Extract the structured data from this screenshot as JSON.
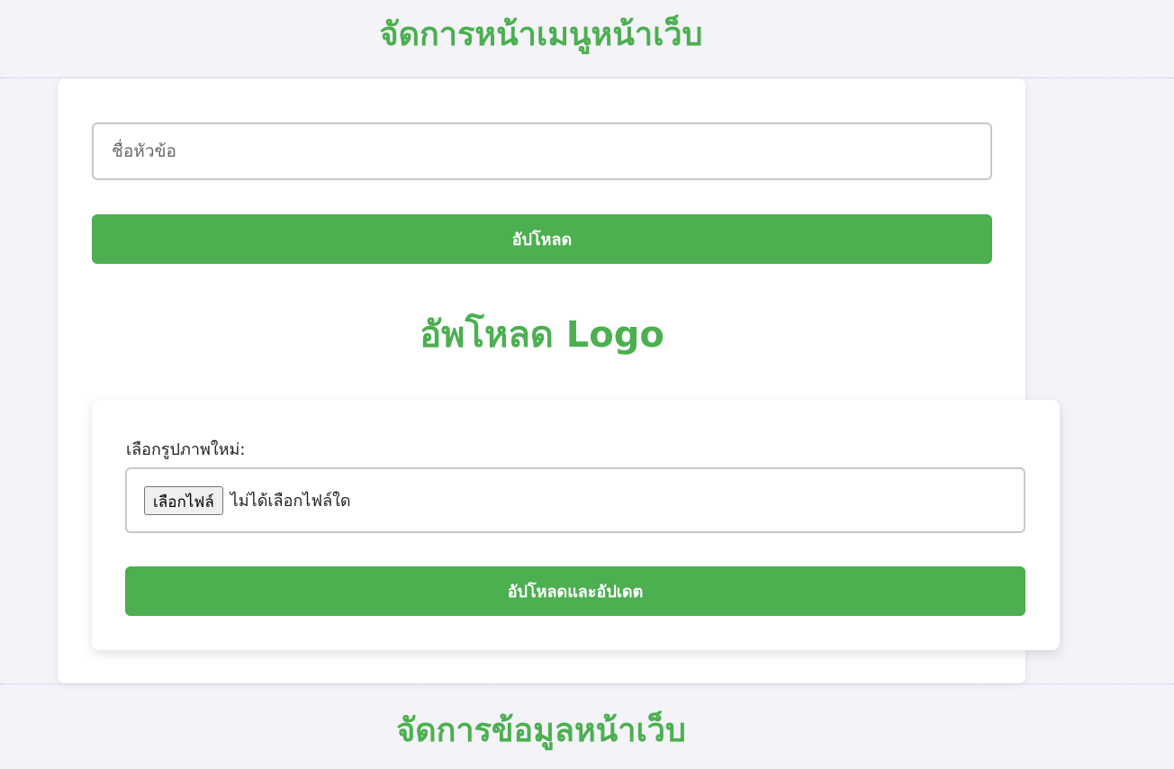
{
  "headings": {
    "menu_section": "จัดการหน้าเมนูหน้าเว็บ",
    "logo_section": "อัพโหลด Logo",
    "data_section": "จัดการข้อมูลหน้าเว็บ"
  },
  "topic_form": {
    "title_input_placeholder": "ชื่อหัวข้อ",
    "title_input_value": "",
    "upload_button_label": "อัปโหลด"
  },
  "logo_form": {
    "file_label": "เลือกรูปภาพใหม่:",
    "choose_file_label": "เลือกไฟล์",
    "file_status": "ไม่ได้เลือกไฟล์ใด",
    "submit_label": "อัปโหลดและอัปเดต"
  },
  "colors": {
    "accent": "#4caf50",
    "background": "#f3f3f8",
    "card": "#ffffff"
  }
}
